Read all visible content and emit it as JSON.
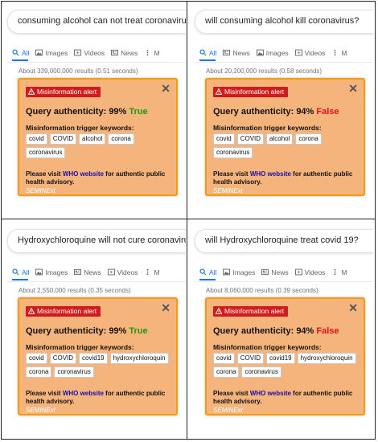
{
  "panels": [
    {
      "query": "consuming alcohol can not treat coronavirus",
      "tabs": [
        "All",
        "Images",
        "Videos",
        "News",
        "M"
      ],
      "tab_icons": [
        "search-icon",
        "images-icon",
        "videos-icon",
        "news-icon",
        "more-icon"
      ],
      "results": "About 339,000,000 results (0.51 seconds)",
      "alert_label": "Misinformation alert",
      "authenticity_label": "Query authenticity:",
      "authenticity_percent": "99%",
      "verdict": "True",
      "keywords_label": "Misinformation trigger keywords:",
      "keywords": [
        "covid",
        "COVID",
        "alcohol",
        "corona",
        "coronavirus"
      ],
      "visit_pre": "Please visit ",
      "who_link": "WHO website",
      "visit_post": " for authentic public health advisory.",
      "signature": "SEMINExt"
    },
    {
      "query": "will consuming alcohol kill coronavirus?",
      "tabs": [
        "All",
        "News",
        "Images",
        "Videos",
        "M"
      ],
      "tab_icons": [
        "search-icon",
        "news-icon",
        "images-icon",
        "videos-icon",
        "more-icon"
      ],
      "results": "About 20,200,000 results (0.58 seconds)",
      "alert_label": "Misinformation alert",
      "authenticity_label": "Query authenticity:",
      "authenticity_percent": "94%",
      "verdict": "False",
      "keywords_label": "Misinformation trigger keywords:",
      "keywords": [
        "covid",
        "COVID",
        "alcohol",
        "corona",
        "coronavirus"
      ],
      "visit_pre": "Please visit ",
      "who_link": "WHO website",
      "visit_post": " for authentic public health advisory.",
      "signature": "SEMINExt"
    },
    {
      "query": "Hydroxychloroquine will not cure coronavirus",
      "tabs": [
        "All",
        "Images",
        "News",
        "Videos",
        "M"
      ],
      "tab_icons": [
        "search-icon",
        "images-icon",
        "news-icon",
        "videos-icon",
        "more-icon"
      ],
      "results": "About 2,550,000 results (0.35 seconds)",
      "alert_label": "Misinformation alert",
      "authenticity_label": "Query authenticity:",
      "authenticity_percent": "99%",
      "verdict": "True",
      "keywords_label": "Misinformation trigger keywords:",
      "keywords": [
        "covid",
        "COVID",
        "covid19",
        "hydroxychloroquin",
        "corona",
        "coronavirus"
      ],
      "visit_pre": "Please visit ",
      "who_link": "WHO website",
      "visit_post": " for authentic public health advisory.",
      "signature": "SEMINExt"
    },
    {
      "query": "will Hydroxychloroquine treat covid 19?",
      "tabs": [
        "All",
        "Images",
        "News",
        "Videos",
        "M"
      ],
      "tab_icons": [
        "search-icon",
        "images-icon",
        "news-icon",
        "videos-icon",
        "more-icon"
      ],
      "results": "About 8,060,000 results (0.39 seconds)",
      "alert_label": "Misinformation alert",
      "authenticity_label": "Query authenticity:",
      "authenticity_percent": "94%",
      "verdict": "False",
      "keywords_label": "Misinformation trigger keywords:",
      "keywords": [
        "covid",
        "COVID",
        "covid19",
        "hydroxychloroquin",
        "corona",
        "coronavirus"
      ],
      "visit_pre": "Please visit ",
      "who_link": "WHO website",
      "visit_post": " for authentic public health advisory.",
      "signature": "SEMINExt"
    }
  ],
  "colors": {
    "alert_bg": "#f5b47c",
    "alert_border": "#f39c12",
    "badge": "#d01c1c",
    "true": "#1e9b0f",
    "false": "#e0101a",
    "link": "#1a0dab",
    "tab_active": "#1a73e8"
  }
}
